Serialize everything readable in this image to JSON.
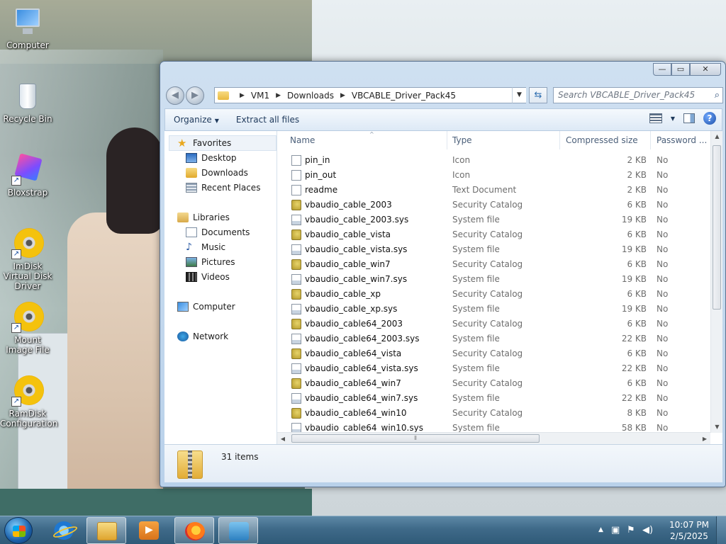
{
  "desktop": {
    "icons": [
      {
        "label": "Computer",
        "icon": "computer-icon"
      },
      {
        "label": "Recycle Bin",
        "icon": "recycle-bin-icon"
      },
      {
        "label": "Bloxstrap",
        "icon": "bloxstrap-icon"
      },
      {
        "label": "ImDisk Virtual Disk Driver",
        "icon": "disc-icon"
      },
      {
        "label": "Mount Image File",
        "icon": "disc-icon"
      },
      {
        "label": "RamDisk Configuration",
        "icon": "disc-icon"
      }
    ]
  },
  "window": {
    "buttons": {
      "minimize": "—",
      "maximize": "▭",
      "close": "✕"
    },
    "breadcrumb": [
      "VM1",
      "Downloads",
      "VBCABLE_Driver_Pack45"
    ],
    "search_placeholder": "Search VBCABLE_Driver_Pack45",
    "toolbar": {
      "organize": "Organize",
      "extract": "Extract all files"
    },
    "nav": {
      "favorites": "Favorites",
      "desktop": "Desktop",
      "downloads": "Downloads",
      "recent": "Recent Places",
      "libraries": "Libraries",
      "documents": "Documents",
      "music": "Music",
      "pictures": "Pictures",
      "videos": "Videos",
      "computer": "Computer",
      "network": "Network"
    },
    "columns": {
      "name": "Name",
      "type": "Type",
      "size": "Compressed size",
      "password": "Password ..."
    },
    "files": [
      {
        "name": "pin_in",
        "type": "Icon",
        "size": "2 KB",
        "password": "No",
        "icon": "plain"
      },
      {
        "name": "pin_out",
        "type": "Icon",
        "size": "2 KB",
        "password": "No",
        "icon": "plain"
      },
      {
        "name": "readme",
        "type": "Text Document",
        "size": "2 KB",
        "password": "No",
        "icon": "plain"
      },
      {
        "name": "vbaudio_cable_2003",
        "type": "Security Catalog",
        "size": "6 KB",
        "password": "No",
        "icon": "cat"
      },
      {
        "name": "vbaudio_cable_2003.sys",
        "type": "System file",
        "size": "19 KB",
        "password": "No",
        "icon": "sys"
      },
      {
        "name": "vbaudio_cable_vista",
        "type": "Security Catalog",
        "size": "6 KB",
        "password": "No",
        "icon": "cat"
      },
      {
        "name": "vbaudio_cable_vista.sys",
        "type": "System file",
        "size": "19 KB",
        "password": "No",
        "icon": "sys"
      },
      {
        "name": "vbaudio_cable_win7",
        "type": "Security Catalog",
        "size": "6 KB",
        "password": "No",
        "icon": "cat"
      },
      {
        "name": "vbaudio_cable_win7.sys",
        "type": "System file",
        "size": "19 KB",
        "password": "No",
        "icon": "sys"
      },
      {
        "name": "vbaudio_cable_xp",
        "type": "Security Catalog",
        "size": "6 KB",
        "password": "No",
        "icon": "cat"
      },
      {
        "name": "vbaudio_cable_xp.sys",
        "type": "System file",
        "size": "19 KB",
        "password": "No",
        "icon": "sys"
      },
      {
        "name": "vbaudio_cable64_2003",
        "type": "Security Catalog",
        "size": "6 KB",
        "password": "No",
        "icon": "cat"
      },
      {
        "name": "vbaudio_cable64_2003.sys",
        "type": "System file",
        "size": "22 KB",
        "password": "No",
        "icon": "sys"
      },
      {
        "name": "vbaudio_cable64_vista",
        "type": "Security Catalog",
        "size": "6 KB",
        "password": "No",
        "icon": "cat"
      },
      {
        "name": "vbaudio_cable64_vista.sys",
        "type": "System file",
        "size": "22 KB",
        "password": "No",
        "icon": "sys"
      },
      {
        "name": "vbaudio_cable64_win7",
        "type": "Security Catalog",
        "size": "6 KB",
        "password": "No",
        "icon": "cat"
      },
      {
        "name": "vbaudio_cable64_win7.sys",
        "type": "System file",
        "size": "22 KB",
        "password": "No",
        "icon": "sys"
      },
      {
        "name": "vbaudio_cable64_win10",
        "type": "Security Catalog",
        "size": "8 KB",
        "password": "No",
        "icon": "cat"
      },
      {
        "name": "vbaudio_cable64_win10.sys",
        "type": "System file",
        "size": "58 KB",
        "password": "No",
        "icon": "sys"
      }
    ],
    "status": {
      "count": "31 items"
    }
  },
  "taskbar": {
    "apps": [
      "internet-explorer",
      "windows-explorer",
      "media-player",
      "firefox",
      "dolphin"
    ],
    "clock": {
      "time": "10:07 PM",
      "date": "2/5/2025"
    }
  }
}
